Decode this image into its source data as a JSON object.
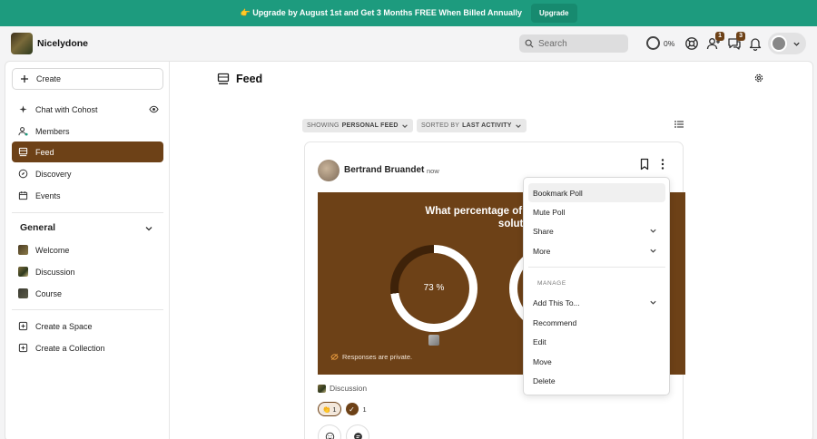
{
  "colors": {
    "brand": "#6d4117",
    "banner": "#1d9b7e",
    "upgrade_button": "#178a6f"
  },
  "banner": {
    "message": "👉 Upgrade by August 1st and Get 3 Months FREE When Billed Annually",
    "button_label": "Upgrade"
  },
  "header": {
    "brand_name": "Nicelydone",
    "search_placeholder": "Search",
    "progress_value": "0%",
    "notifications": {
      "people_count": "1",
      "messages_count": "3"
    }
  },
  "sidebar": {
    "create_label": "Create",
    "items": [
      {
        "label": "Chat with Cohost",
        "icon": "sparkle-icon"
      },
      {
        "label": "Members",
        "icon": "members-icon"
      },
      {
        "label": "Feed",
        "icon": "feed-icon",
        "active": true
      },
      {
        "label": "Discovery",
        "icon": "compass-icon"
      },
      {
        "label": "Events",
        "icon": "calendar-icon"
      }
    ],
    "group_title": "General",
    "spaces": [
      {
        "label": "Welcome"
      },
      {
        "label": "Discussion"
      },
      {
        "label": "Course"
      }
    ],
    "actions": [
      {
        "label": "Create a Space"
      },
      {
        "label": "Create a Collection"
      }
    ]
  },
  "main": {
    "title": "Feed",
    "filter_showing_prefix": "SHOWING",
    "filter_showing_value": "PERSONAL FEED",
    "filter_sorted_prefix": "SORTED BY",
    "filter_sorted_value": "LAST ACTIVITY"
  },
  "post": {
    "author": "Bertrand Bruandet",
    "time": "now",
    "poll_question_line1": "What percentage of your current project",
    "poll_question_line2": "solutions?",
    "option1_percent": "73 %",
    "option1_fraction": 0.73,
    "responses_note": "Responses are private.",
    "space": "Discussion",
    "reaction_count": "1",
    "check_count": "1"
  },
  "menu": {
    "items": [
      {
        "label": "Bookmark Poll"
      },
      {
        "label": "Mute Poll"
      },
      {
        "label": "Share"
      },
      {
        "label": "More"
      }
    ],
    "section_label": "MANAGE",
    "manage_items": [
      {
        "label": "Add This To..."
      },
      {
        "label": "Recommend"
      },
      {
        "label": "Edit"
      },
      {
        "label": "Move"
      },
      {
        "label": "Delete"
      }
    ]
  }
}
